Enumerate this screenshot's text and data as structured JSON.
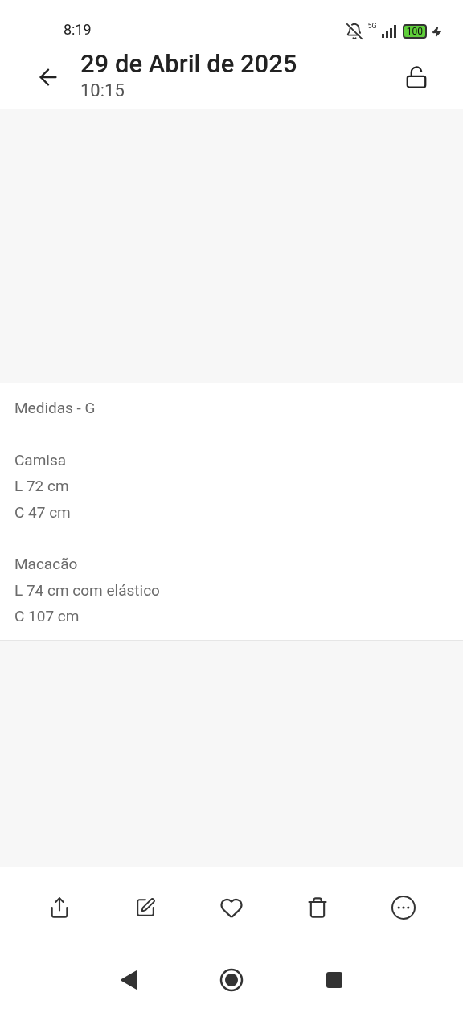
{
  "status_bar": {
    "time": "8:19",
    "network": "5G",
    "battery": "100"
  },
  "header": {
    "title": "29 de Abril de 2025",
    "subtitle": "10:15"
  },
  "note": {
    "paragraphs": [
      [
        "Medidas - G"
      ],
      [
        "Camisa",
        "L 72 cm",
        "C 47 cm"
      ],
      [
        "Macacão",
        "L 74 cm com elástico",
        "C 107 cm"
      ]
    ]
  }
}
